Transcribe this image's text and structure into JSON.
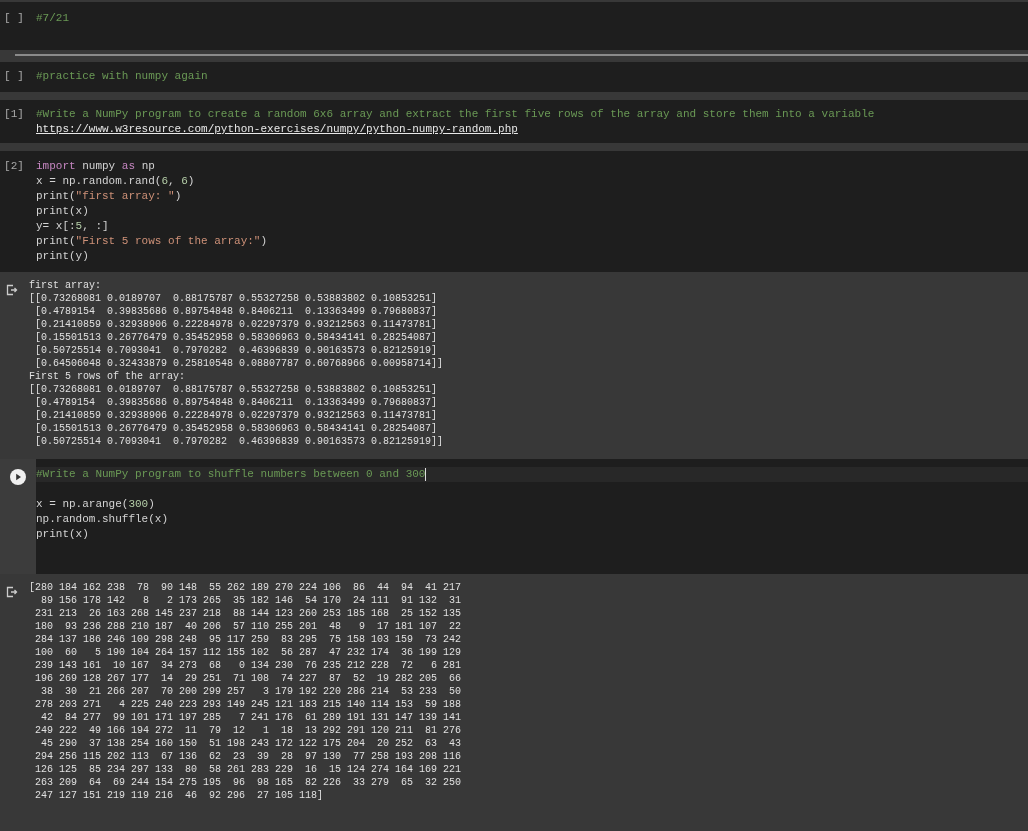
{
  "cells": [
    {
      "prompt": "[ ]",
      "focused": false,
      "lines": [
        [
          {
            "kind": "comment",
            "text": "#7/21"
          }
        ]
      ]
    },
    {
      "prompt": "[ ]",
      "focused": false,
      "lines": [
        [
          {
            "kind": "comment",
            "text": "#practice with numpy again"
          }
        ]
      ]
    },
    {
      "prompt": "[1]",
      "focused": false,
      "lines": [
        [
          {
            "kind": "comment",
            "text": "#Write a NumPy program to create a random 6x6 array and extract the first five rows of the array and store them into a variable"
          }
        ],
        [
          {
            "kind": "link",
            "text": "https://www.w3resource.com/python-exercises/numpy/python-numpy-random.php"
          }
        ]
      ]
    },
    {
      "prompt": "[2]",
      "focused": false,
      "lines": [
        [
          {
            "kind": "keyword",
            "text": "import"
          },
          {
            "kind": "plain",
            "text": " numpy "
          },
          {
            "kind": "keyword",
            "text": "as"
          },
          {
            "kind": "plain",
            "text": " np"
          }
        ],
        [
          {
            "kind": "plain",
            "text": "x = np.random.rand("
          },
          {
            "kind": "number",
            "text": "6"
          },
          {
            "kind": "plain",
            "text": ", "
          },
          {
            "kind": "number",
            "text": "6"
          },
          {
            "kind": "plain",
            "text": ")"
          }
        ],
        [
          {
            "kind": "plain",
            "text": "print("
          },
          {
            "kind": "string",
            "text": "\"first array: \""
          },
          {
            "kind": "plain",
            "text": ")"
          }
        ],
        [
          {
            "kind": "plain",
            "text": "print(x)"
          }
        ],
        [
          {
            "kind": "plain",
            "text": "y= x[:"
          },
          {
            "kind": "number",
            "text": "5"
          },
          {
            "kind": "plain",
            "text": ", :]"
          }
        ],
        [
          {
            "kind": "plain",
            "text": "print("
          },
          {
            "kind": "string",
            "text": "\"First 5 rows of the array:\""
          },
          {
            "kind": "plain",
            "text": ")"
          }
        ],
        [
          {
            "kind": "plain",
            "text": "print(y)"
          }
        ]
      ],
      "output": [
        "first array:",
        "[[0.73268081 0.0189707  0.88175787 0.55327258 0.53883802 0.10853251]",
        " [0.4789154  0.39835686 0.89754848 0.8406211  0.13363499 0.79680837]",
        " [0.21410859 0.32938906 0.22284978 0.02297379 0.93212563 0.11473781]",
        " [0.15501513 0.26776479 0.35452958 0.58306963 0.58434141 0.28254087]",
        " [0.50725514 0.7093041  0.7970282  0.46396839 0.90163573 0.82125919]",
        " [0.64506048 0.32433879 0.25810548 0.08807787 0.60768966 0.00958714]]",
        "First 5 rows of the array:",
        "[[0.73268081 0.0189707  0.88175787 0.55327258 0.53883802 0.10853251]",
        " [0.4789154  0.39835686 0.89754848 0.8406211  0.13363499 0.79680837]",
        " [0.21410859 0.32938906 0.22284978 0.02297379 0.93212563 0.11473781]",
        " [0.15501513 0.26776479 0.35452958 0.58306963 0.58434141 0.28254087]",
        " [0.50725514 0.7093041  0.7970282  0.46396839 0.90163573 0.82125919]]"
      ]
    },
    {
      "focused": true,
      "lines": [
        [
          {
            "kind": "comment",
            "text": "#Write a NumPy program to shuffle numbers between 0 and 300"
          }
        ],
        [
          {
            "kind": "plain",
            "text": "x = np.arange("
          },
          {
            "kind": "number",
            "text": "300"
          },
          {
            "kind": "plain",
            "text": ")"
          }
        ],
        [
          {
            "kind": "plain",
            "text": "np.random.shuffle(x)"
          }
        ],
        [
          {
            "kind": "plain",
            "text": "print(x)"
          }
        ]
      ],
      "output": [
        "[280 184 162 238  78  90 148  55 262 189 270 224 106  86  44  94  41 217",
        "  89 156 178 142   8   2 173 265  35 182 146  54 170  24 111  91 132  31",
        " 231 213  26 163 268 145 237 218  88 144 123 260 253 185 168  25 152 135",
        " 180  93 236 288 210 187  40 206  57 110 255 201  48   9  17 181 107  22",
        " 284 137 186 246 109 298 248  95 117 259  83 295  75 158 103 159  73 242",
        " 100  60   5 190 104 264 157 112 155 102  56 287  47 232 174  36 199 129",
        " 239 143 161  10 167  34 273  68   0 134 230  76 235 212 228  72   6 281",
        " 196 269 128 267 177  14  29 251  71 108  74 227  87  52  19 282 205  66",
        "  38  30  21 266 207  70 200 299 257   3 179 192 220 286 214  53 233  50",
        " 278 203 271   4 225 240 223 293 149 245 121 183 215 140 114 153  59 188",
        "  42  84 277  99 101 171 197 285   7 241 176  61 289 191 131 147 139 141",
        " 249 222  49 166 194 272  11  79  12   1  18  13 292 291 120 211  81 276",
        "  45 290  37 138 254 160 150  51 198 243 172 122 175 204  20 252  63  43",
        " 294 256 115 202 113  67 136  62  23  39  28  97 130  77 258 193 208 116",
        " 126 125  85 234 297 133  80  58 261 283 229  16  15 124 274 164 169 221",
        " 263 209  64  69 244 154 275 195  96  98 165  82 226  33 279  65  32 250",
        " 247 127 151 219 119 216  46  92 296  27 105 118]"
      ]
    }
  ]
}
